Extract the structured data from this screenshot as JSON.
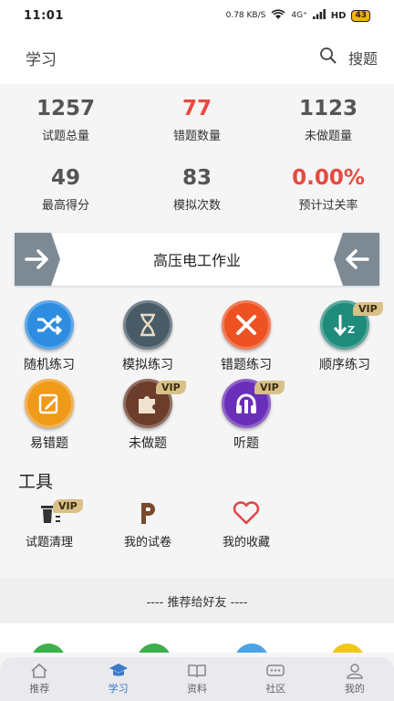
{
  "status_bar": {
    "time": "11:01",
    "net_speed": "0.78 KB/S",
    "signal": "4G⁺",
    "hd": "HD",
    "battery": "43"
  },
  "header": {
    "title": "学习",
    "search_label": "搜题"
  },
  "stats": [
    {
      "value": "1257",
      "label": "试题总量",
      "highlight": false
    },
    {
      "value": "77",
      "label": "错题数量",
      "highlight": true
    },
    {
      "value": "1123",
      "label": "未做题量",
      "highlight": false
    },
    {
      "value": "49",
      "label": "最高得分",
      "highlight": false
    },
    {
      "value": "83",
      "label": "模拟次数",
      "highlight": false
    },
    {
      "value": "0.00%",
      "label": "预计过关率",
      "highlight": true
    }
  ],
  "subject": {
    "label": "高压电工作业",
    "prev_icon": "arrow-right-icon",
    "next_icon": "arrow-left-icon"
  },
  "practice": [
    {
      "label": "随机练习",
      "icon": "shuffle-icon",
      "color": "#2e8de0",
      "vip": false
    },
    {
      "label": "模拟练习",
      "icon": "hourglass-icon",
      "color": "#4a5b68",
      "vip": false
    },
    {
      "label": "错题练习",
      "icon": "close-icon",
      "color": "#ee5122",
      "vip": false
    },
    {
      "label": "顺序练习",
      "icon": "sort-down-icon",
      "color": "#1f8b7a",
      "vip": true
    },
    {
      "label": "易错题",
      "icon": "edit-note-icon",
      "color": "#f09a1a",
      "vip": false
    },
    {
      "label": "未做题",
      "icon": "puzzle-icon",
      "color": "#6b3d2a",
      "vip": true
    },
    {
      "label": "听题",
      "icon": "listen-icon",
      "color": "#6a2fb8",
      "vip": true
    }
  ],
  "tools": {
    "title": "工具",
    "items": [
      {
        "label": "试题清理",
        "icon": "trash-icon",
        "vip": true
      },
      {
        "label": "我的试卷",
        "icon": "paper-icon",
        "vip": false
      },
      {
        "label": "我的收藏",
        "icon": "heart-icon",
        "vip": false
      }
    ]
  },
  "vip_label": "VIP",
  "recommend": "---- 推荐给好友 ----",
  "tabs": [
    {
      "label": "推荐",
      "icon": "home-icon",
      "active": false
    },
    {
      "label": "学习",
      "icon": "graduation-cap-icon",
      "active": true
    },
    {
      "label": "资料",
      "icon": "book-icon",
      "active": false
    },
    {
      "label": "社区",
      "icon": "chat-icon",
      "active": false
    },
    {
      "label": "我的",
      "icon": "user-icon",
      "active": false
    }
  ],
  "colors": {
    "accent": "#3b79c9",
    "highlight_red": "#e8493f",
    "vip_gold": "#d9c089"
  }
}
